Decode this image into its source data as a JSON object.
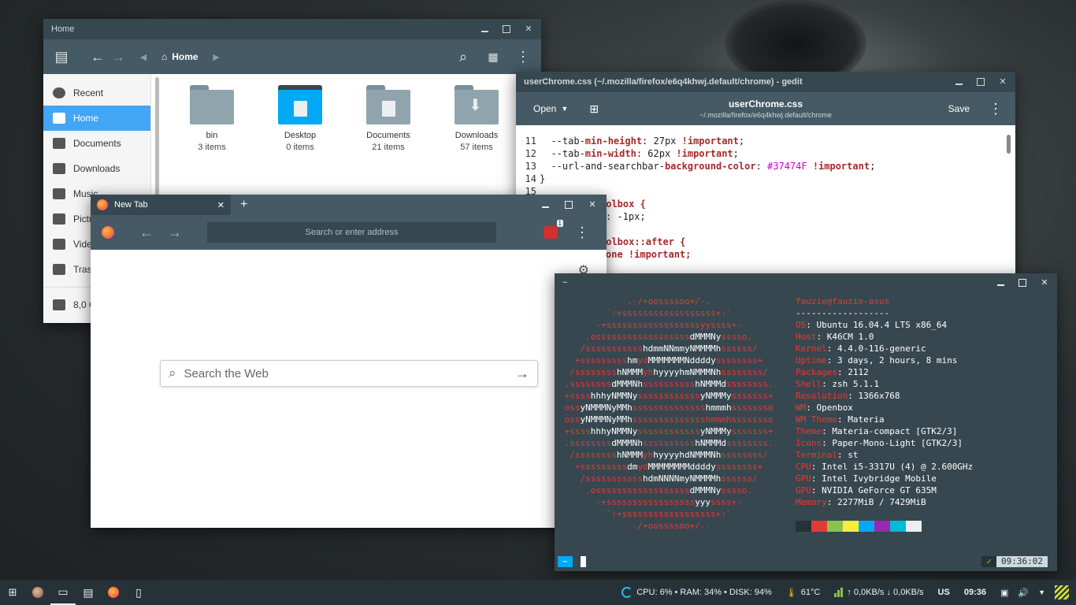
{
  "files": {
    "title": "Home",
    "breadcrumb": "Home",
    "sidebar": [
      {
        "label": "Recent",
        "icon": "clock-icon"
      },
      {
        "label": "Home",
        "icon": "home-icon"
      },
      {
        "label": "Documents",
        "icon": "document-icon"
      },
      {
        "label": "Downloads",
        "icon": "download-icon"
      },
      {
        "label": "Music",
        "icon": "music-icon"
      },
      {
        "label": "Pictu",
        "icon": "image-icon"
      },
      {
        "label": "Vide",
        "icon": "video-icon"
      },
      {
        "label": "Tras",
        "icon": "trash-icon"
      },
      {
        "label": "8,0 G",
        "icon": "drive-icon"
      }
    ],
    "items": [
      {
        "name": "bin",
        "count": "3 items"
      },
      {
        "name": "Desktop",
        "count": "0 items"
      },
      {
        "name": "Documents",
        "count": "21 items"
      },
      {
        "name": "Downloads",
        "count": "57 items"
      }
    ]
  },
  "gedit": {
    "window_title": "userChrome.css (~/.mozilla/firefox/e6q4khwj.default/chrome) - gedit",
    "open_label": "Open",
    "save_label": "Save",
    "file_name": "userChrome.css",
    "file_path": "~/.mozilla/firefox/e6q4khwj.default/chrome",
    "lines": [
      {
        "n": "11",
        "a": "  --tab-",
        "k": "min-height",
        "b": ": 27px ",
        "imp": "!important",
        "c": ";"
      },
      {
        "n": "12",
        "a": "  --tab-",
        "k": "min-width",
        "b": ": 62px ",
        "imp": "!important",
        "c": ";"
      },
      {
        "n": "13",
        "a": "  --url-and-searchbar-",
        "k": "background-color",
        "b": ": ",
        "hex": "#37474F",
        "imp": "!important",
        "c": ";"
      },
      {
        "n": "14",
        "a": "}"
      },
      {
        "n": "15",
        "a": ""
      }
    ],
    "frag1": "oolbox {",
    "frag2": ": -1px;",
    "frag3": "oolbox::after {",
    "frag4": "one !important;"
  },
  "firefox": {
    "tab_title": "New Tab",
    "address_placeholder": "Search or enter address",
    "badge_count": "1",
    "search_placeholder": "Search the Web"
  },
  "terminal": {
    "title": "~",
    "user_host": "fauzie@fauzie-asus",
    "separator": "------------------",
    "info": [
      {
        "k": "OS",
        "v": "Ubuntu 16.04.4 LTS x86_64"
      },
      {
        "k": "Host",
        "v": "K46CM 1.0"
      },
      {
        "k": "Kernel",
        "v": "4.4.0-116-generic"
      },
      {
        "k": "Uptime",
        "v": "3 days, 2 hours, 8 mins"
      },
      {
        "k": "Packages",
        "v": "2112"
      },
      {
        "k": "Shell",
        "v": "zsh 5.1.1"
      },
      {
        "k": "Resolution",
        "v": "1366x768"
      },
      {
        "k": "WM",
        "v": "Openbox"
      },
      {
        "k": "WM Theme",
        "v": "Materia"
      },
      {
        "k": "Theme",
        "v": "Materia-compact [GTK2/3]"
      },
      {
        "k": "Icons",
        "v": "Paper-Mono-Light [GTK2/3]"
      },
      {
        "k": "Terminal",
        "v": "st"
      },
      {
        "k": "CPU",
        "v": "Intel i5-3317U (4) @ 2.600GHz"
      },
      {
        "k": "GPU",
        "v": "Intel Ivybridge Mobile"
      },
      {
        "k": "GPU",
        "v": "NVIDIA GeForce GT 635M"
      },
      {
        "k": "Memory",
        "v": "2277MiB / 7429MiB"
      }
    ],
    "swatches": [
      "#263238",
      "#e53935",
      "#8bc34a",
      "#ffeb3b",
      "#03a9f4",
      "#9c27b0",
      "#00bcd4",
      "#eceff1"
    ],
    "prompt": "~",
    "status_ok": "✓",
    "time": "09:36:02"
  },
  "panel": {
    "sysinfo": "CPU: 6% • RAM: 34% • DISK: 94%",
    "temp": "61°C",
    "net": "↑ 0,0KB/s ↓ 0,0KB/s",
    "layout": "US",
    "clock": "09:36"
  }
}
